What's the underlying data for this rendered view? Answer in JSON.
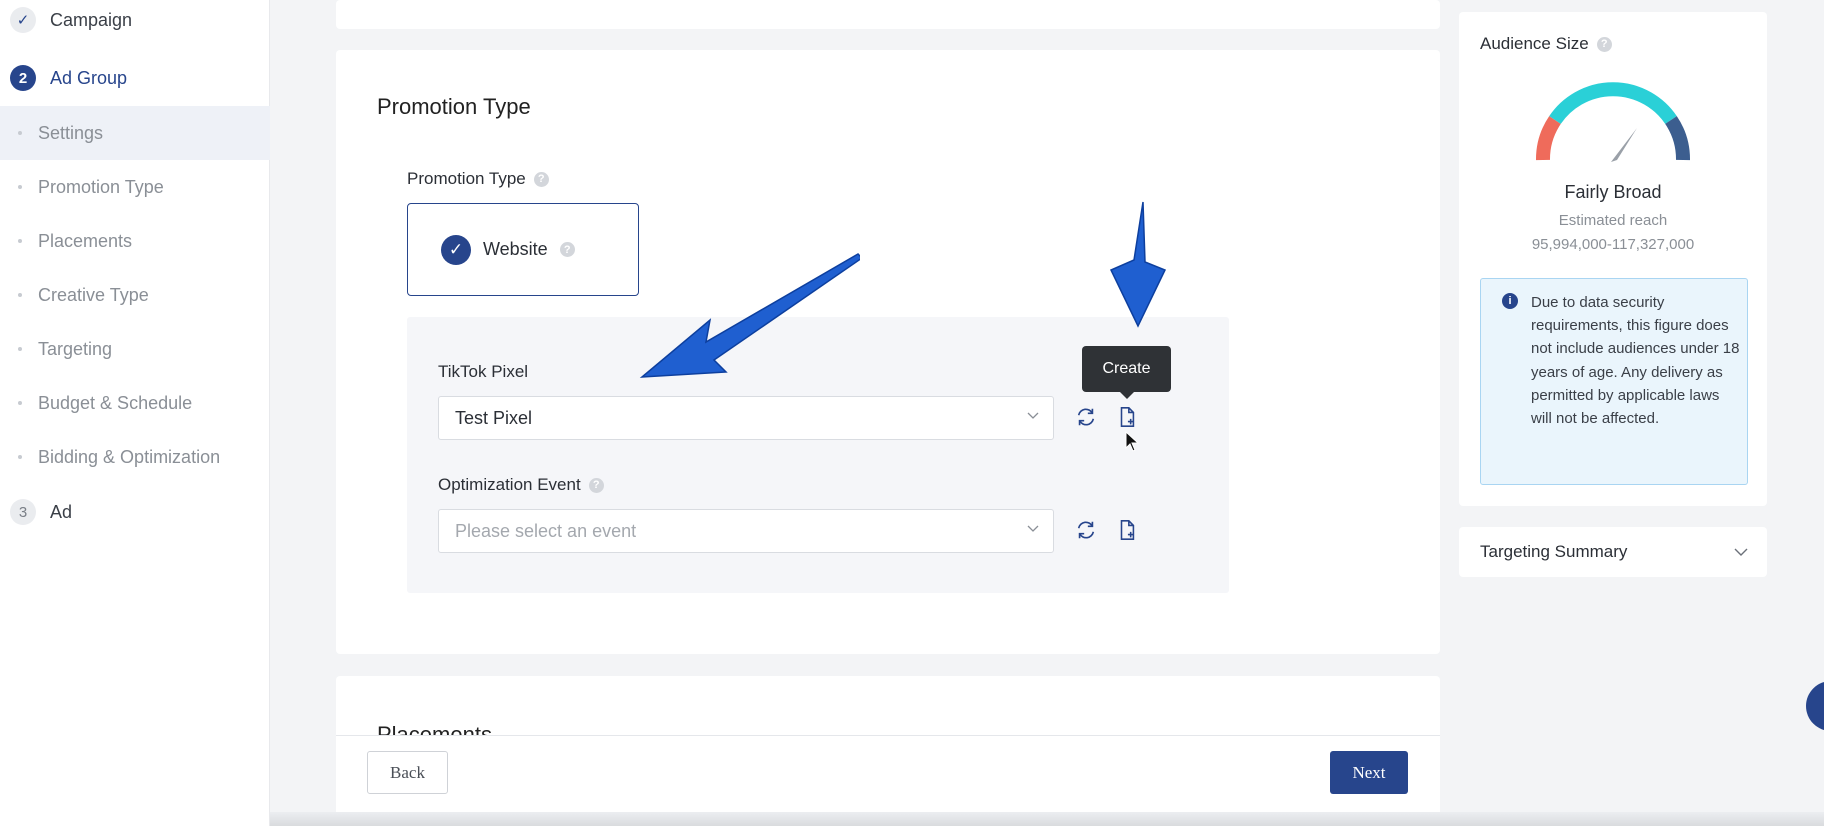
{
  "sidebar": {
    "steps": [
      {
        "num": "✓",
        "label": "Campaign"
      },
      {
        "num": "2",
        "label": "Ad Group"
      },
      {
        "num": "3",
        "label": "Ad"
      }
    ],
    "items": [
      "Settings",
      "Promotion Type",
      "Placements",
      "Creative Type",
      "Targeting",
      "Budget & Schedule",
      "Bidding & Optimization"
    ],
    "active_item": "Settings"
  },
  "main": {
    "section_title": "Promotion Type",
    "promotion_type_label": "Promotion Type",
    "website_option": "Website",
    "pixel_label": "TikTok Pixel",
    "pixel_value": "Test Pixel",
    "event_label": "Optimization Event",
    "event_placeholder": "Please select an event",
    "tooltip": "Create",
    "next_section_title": "Placements"
  },
  "footer": {
    "back": "Back",
    "next": "Next"
  },
  "audience": {
    "title": "Audience Size",
    "breadth": "Fairly Broad",
    "reach_label": "Estimated reach",
    "reach_value": "95,994,000-117,327,000",
    "notice": "Due to data security requirements, this figure does not include audiences under 18 years of age. Any delivery as permitted by applicable laws will not be affected."
  },
  "targeting_summary": "Targeting Summary",
  "colors": {
    "primary": "#27458c",
    "arrow": "#1f5fd0",
    "gauge_red": "#ef6b5b",
    "gauge_teal": "#2ad0d7",
    "gauge_navy": "#3c5e8f"
  }
}
